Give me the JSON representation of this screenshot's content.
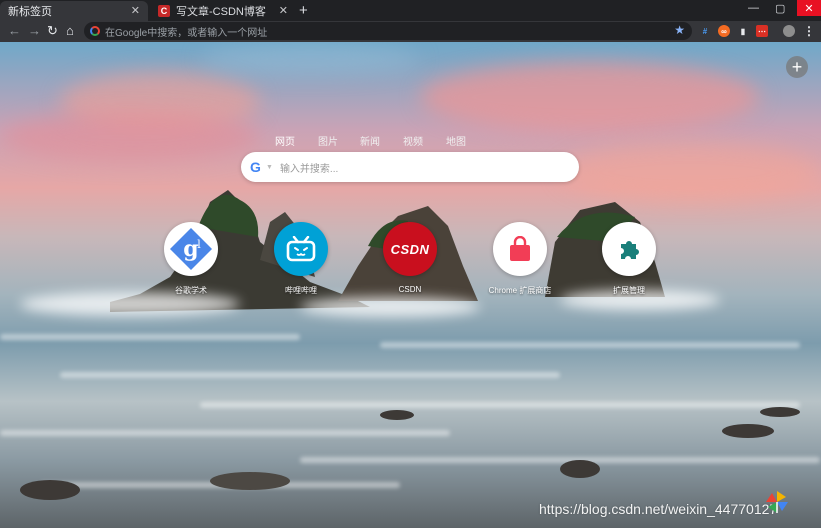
{
  "tabs": [
    {
      "title": "新标签页",
      "active": true
    },
    {
      "title": "写文章-CSDN博客",
      "active": false
    }
  ],
  "window_controls": {
    "restore": "▢",
    "close": "✕"
  },
  "omnibox": {
    "placeholder": "在Google中搜索，或者输入一个网址"
  },
  "extensions": [
    {
      "icon": "hash-extension-icon",
      "glyph": "#",
      "color": "#1f78d1"
    },
    {
      "icon": "orange-extension-icon",
      "glyph": "∞",
      "color": "#f46b22"
    },
    {
      "icon": "bookmark-icon",
      "glyph": "❚",
      "color": "#e8eaed"
    },
    {
      "icon": "red-extension-icon",
      "glyph": "▪",
      "color": "#d93025"
    }
  ],
  "search": {
    "tabs": [
      "网页",
      "图片",
      "新闻",
      "视频",
      "地图"
    ],
    "placeholder": "输入并搜索..."
  },
  "shortcuts": [
    {
      "label": "谷歌学术",
      "icon": "google-scholar-icon"
    },
    {
      "label": "哔哩哔哩",
      "icon": "bilibili-icon"
    },
    {
      "label": "CSDN",
      "icon": "csdn-icon"
    },
    {
      "label": "Chrome 扩展商店",
      "icon": "chrome-web-store-icon"
    },
    {
      "label": "扩展管理",
      "icon": "puzzle-icon"
    }
  ],
  "csdn_logo_text": "CSDN",
  "watermark": "https://blog.csdn.net/weixin_44770127",
  "colors": {
    "tabstrip": "#202124",
    "toolbar": "#35363a",
    "bilibili": "#00a1d6",
    "csdn": "#c90f1e",
    "store": "#f23d56",
    "puzzle": "#1a7f7a"
  }
}
